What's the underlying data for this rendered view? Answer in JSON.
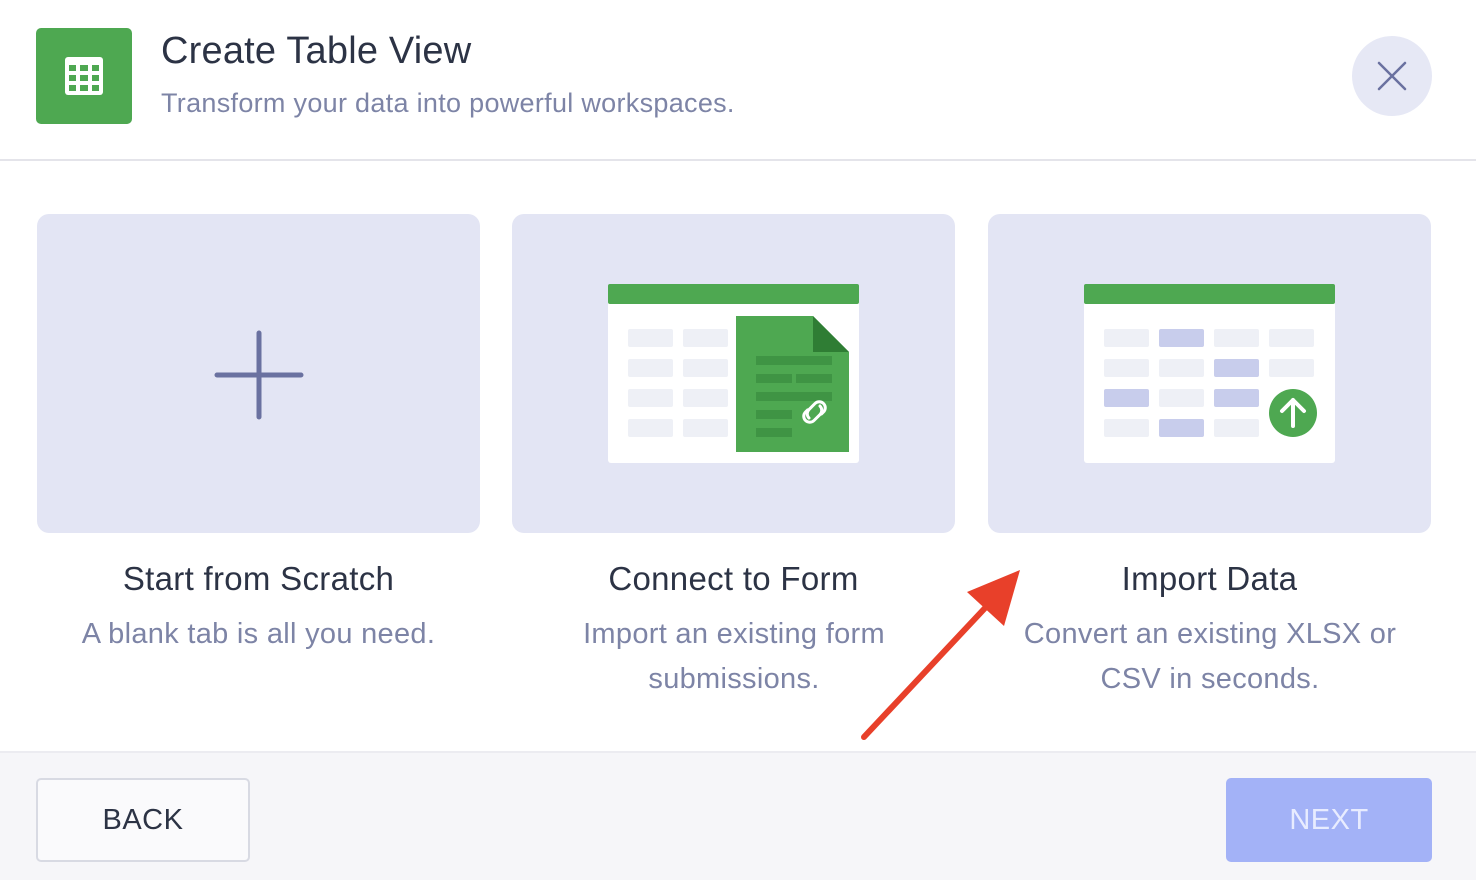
{
  "header": {
    "title": "Create Table View",
    "subtitle": "Transform your data into powerful workspaces.",
    "icon": "table-grid-icon",
    "close_icon": "close-icon"
  },
  "options": [
    {
      "title": "Start from Scratch",
      "description": "A blank tab is all you need.",
      "icon": "plus-icon"
    },
    {
      "title": "Connect to Form",
      "description": "Import an existing form submissions.",
      "icon": "form-sheet-link-icon"
    },
    {
      "title": "Import Data",
      "description": "Convert an existing XLSX or CSV in seconds.",
      "icon": "table-upload-icon"
    }
  ],
  "footer": {
    "back_label": "BACK",
    "next_label": "NEXT"
  },
  "colors": {
    "brand_green": "#4ea851",
    "card_bg": "#e3e5f4",
    "next_disabled": "#a3b2f7",
    "annotation_arrow": "#e8402a"
  }
}
